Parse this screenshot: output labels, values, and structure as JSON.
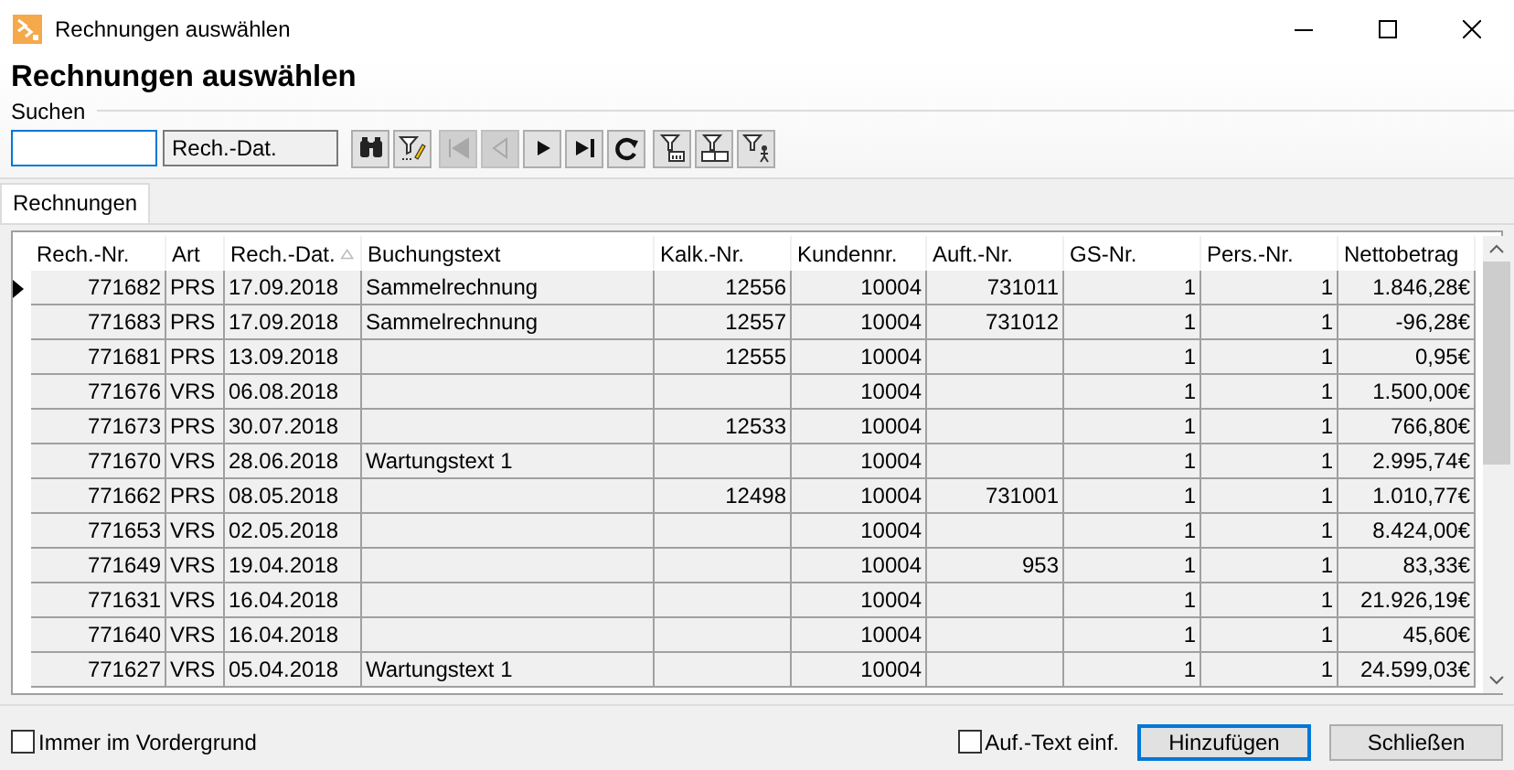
{
  "window": {
    "title": "Rechnungen auswählen"
  },
  "header": {
    "title": "Rechnungen auswählen",
    "search_label": "Suchen",
    "sort_field": "Rech.-Dat."
  },
  "toolbar": [
    [
      {
        "kind": "find",
        "disabled": false
      },
      {
        "kind": "edit-filter",
        "disabled": false
      }
    ],
    [
      {
        "kind": "first",
        "disabled": true
      },
      {
        "kind": "previous",
        "disabled": true
      },
      {
        "kind": "next",
        "disabled": false
      },
      {
        "kind": "last",
        "disabled": false
      },
      {
        "kind": "refresh",
        "disabled": false
      }
    ],
    [
      {
        "kind": "filter-a",
        "disabled": false
      },
      {
        "kind": "filter-b",
        "disabled": false
      },
      {
        "kind": "filter-person",
        "disabled": false
      }
    ]
  ],
  "tabs": [
    {
      "label": "Rechnungen",
      "selected": true
    }
  ],
  "table": {
    "columns": [
      {
        "label": "Rech.-Nr.",
        "kind": "number",
        "sorted": false
      },
      {
        "label": "Art",
        "kind": "text",
        "sorted": false
      },
      {
        "label": "Rech.-Dat.",
        "kind": "text",
        "sorted": true
      },
      {
        "label": "Buchungstext",
        "kind": "text",
        "sorted": false
      },
      {
        "label": "Kalk.-Nr.",
        "kind": "number",
        "sorted": false
      },
      {
        "label": "Kundennr.",
        "kind": "number",
        "sorted": false
      },
      {
        "label": "Auft.-Nr.",
        "kind": "number",
        "sorted": false
      },
      {
        "label": "GS-Nr.",
        "kind": "number",
        "sorted": false
      },
      {
        "label": "Pers.-Nr.",
        "kind": "number",
        "sorted": false
      },
      {
        "label": "Nettobetrag",
        "kind": "number",
        "sorted": false
      }
    ],
    "rows": [
      {
        "selected": true,
        "cells": [
          "771682",
          "PRS",
          "17.09.2018",
          "Sammelrechnung",
          "12556",
          "10004",
          "731011",
          "1",
          "1",
          "1.846,28€"
        ]
      },
      {
        "selected": false,
        "cells": [
          "771683",
          "PRS",
          "17.09.2018",
          "Sammelrechnung",
          "12557",
          "10004",
          "731012",
          "1",
          "1",
          "-96,28€"
        ]
      },
      {
        "selected": false,
        "cells": [
          "771681",
          "PRS",
          "13.09.2018",
          null,
          "12555",
          "10004",
          null,
          "1",
          "1",
          "0,95€"
        ]
      },
      {
        "selected": false,
        "cells": [
          "771676",
          "VRS",
          "06.08.2018",
          null,
          null,
          "10004",
          null,
          "1",
          "1",
          "1.500,00€"
        ]
      },
      {
        "selected": false,
        "cells": [
          "771673",
          "PRS",
          "30.07.2018",
          null,
          "12533",
          "10004",
          null,
          "1",
          "1",
          "766,80€"
        ]
      },
      {
        "selected": false,
        "cells": [
          "771670",
          "VRS",
          "28.06.2018",
          "Wartungstext 1",
          null,
          "10004",
          null,
          "1",
          "1",
          "2.995,74€"
        ]
      },
      {
        "selected": false,
        "cells": [
          "771662",
          "PRS",
          "08.05.2018",
          null,
          "12498",
          "10004",
          "731001",
          "1",
          "1",
          "1.010,77€"
        ]
      },
      {
        "selected": false,
        "cells": [
          "771653",
          "VRS",
          "02.05.2018",
          null,
          null,
          "10004",
          null,
          "1",
          "1",
          "8.424,00€"
        ]
      },
      {
        "selected": false,
        "cells": [
          "771649",
          "VRS",
          "19.04.2018",
          null,
          null,
          "10004",
          "953",
          "1",
          "1",
          "83,33€"
        ]
      },
      {
        "selected": false,
        "cells": [
          "771631",
          "VRS",
          "16.04.2018",
          null,
          null,
          "10004",
          null,
          "1",
          "1",
          "21.926,19€"
        ]
      },
      {
        "selected": false,
        "cells": [
          "771640",
          "VRS",
          "16.04.2018",
          null,
          null,
          "10004",
          null,
          "1",
          "1",
          "45,60€"
        ]
      },
      {
        "selected": false,
        "cells": [
          "771627",
          "VRS",
          "05.04.2018",
          "Wartungstext 1",
          null,
          "10004",
          null,
          "1",
          "1",
          "24.599,03€"
        ]
      }
    ]
  },
  "footer": {
    "always_on_top": {
      "label": "Immer im Vordergrund",
      "checked": false
    },
    "insert_text": {
      "label": "Auf.-Text einf.",
      "checked": false
    },
    "buttons": [
      {
        "label": "Hinzufügen",
        "default": true
      },
      {
        "label": "Schließen",
        "default": false
      }
    ]
  }
}
